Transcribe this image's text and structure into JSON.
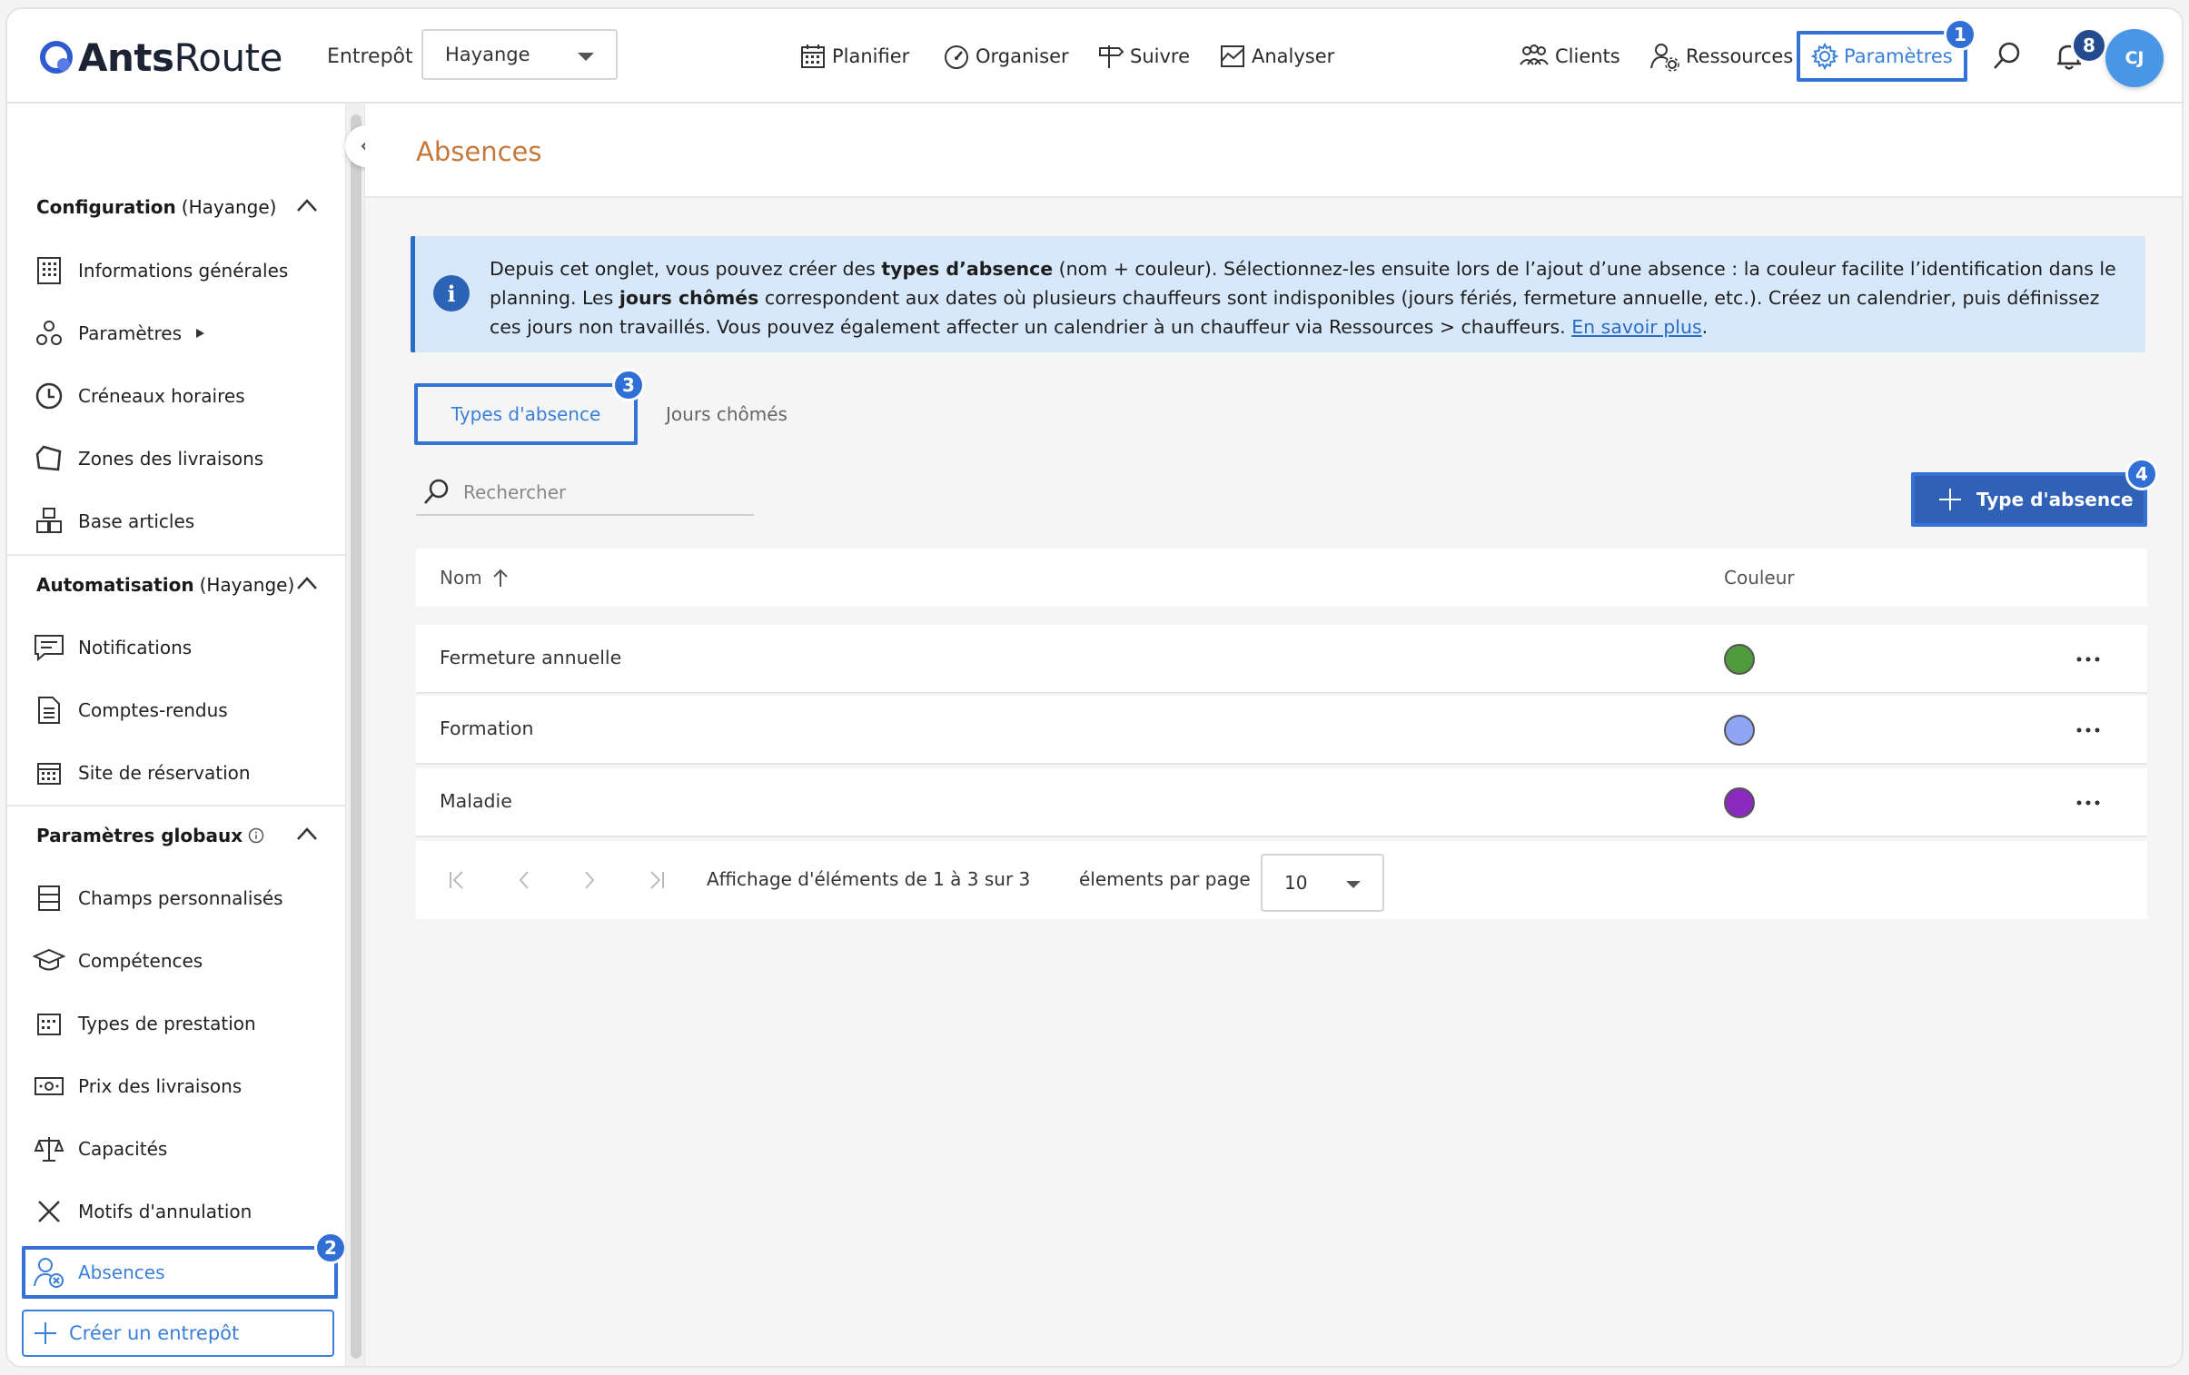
{
  "app": {
    "logo_bold": "Ants",
    "logo_light": "Route"
  },
  "topbar": {
    "entrepot_label": "Entrepôt",
    "entrepot_value": "Hayange",
    "nav": {
      "planifier": "Planifier",
      "organiser": "Organiser",
      "suivre": "Suivre",
      "analyser": "Analyser",
      "clients": "Clients",
      "ressources": "Ressources",
      "parametres": "Paramètres"
    },
    "notifications_count": "8",
    "avatar_initials": "CJ",
    "step_badge": "1"
  },
  "sidebar": {
    "configuration": {
      "title": "Configuration",
      "suffix": "(Hayange)"
    },
    "config_items": {
      "informations": "Informations générales",
      "parametres": "Paramètres",
      "creneaux": "Créneaux horaires",
      "zones": "Zones des livraisons",
      "base_articles": "Base articles"
    },
    "automatisation": {
      "title": "Automatisation",
      "suffix": "(Hayange)"
    },
    "auto_items": {
      "notifications": "Notifications",
      "comptes_rendus": "Comptes-rendus",
      "site_reservation": "Site de réservation"
    },
    "globaux": {
      "title": "Paramètres globaux"
    },
    "global_items": {
      "champs": "Champs personnalisés",
      "competences": "Compétences",
      "types_prestation": "Types de prestation",
      "prix": "Prix des livraisons",
      "capacites": "Capacités",
      "motifs": "Motifs d'annulation",
      "absences": "Absences"
    },
    "absences_badge": "2",
    "create_label": "Créer un entrepôt"
  },
  "page": {
    "title": "Absences",
    "info": {
      "t1": "Depuis cet onglet, vous pouvez créer des ",
      "b1": "types d’absence",
      "t2": " (nom + couleur). Sélectionnez-les ensuite lors de l’ajout d’une absence : la couleur facilite l’identification dans le planning. Les ",
      "b2": "jours chômés",
      "t3": " correspondent aux dates où plusieurs chauffeurs sont indisponibles (jours fériés, fermeture annuelle, etc.). Créez un calendrier, puis définissez ces jours non travaillés. Vous pouvez également affecter un calendrier à un chauffeur via Ressources > chauffeurs. ",
      "link": "En savoir plus",
      "t4": "."
    },
    "tabs": {
      "types": "Types d'absence",
      "jours": "Jours chômés"
    },
    "tab_badge": "3",
    "search_placeholder": "Rechercher",
    "add_button": "Type d'absence",
    "add_badge": "4",
    "table": {
      "col_name": "Nom",
      "col_color": "Couleur",
      "rows": [
        {
          "name": "Fermeture annuelle",
          "color": "#4f9a3a"
        },
        {
          "name": "Formation",
          "color": "#8fa4f4"
        },
        {
          "name": "Maladie",
          "color": "#8a2bbd"
        }
      ]
    },
    "pager": {
      "info": "Affichage d'éléments de 1 à 3 sur 3",
      "per_page_label": "élements par page",
      "per_page_value": "10"
    }
  },
  "colors": {
    "accent": "#3472d8",
    "title": "#c77739",
    "primary_button": "#2f62b6"
  }
}
